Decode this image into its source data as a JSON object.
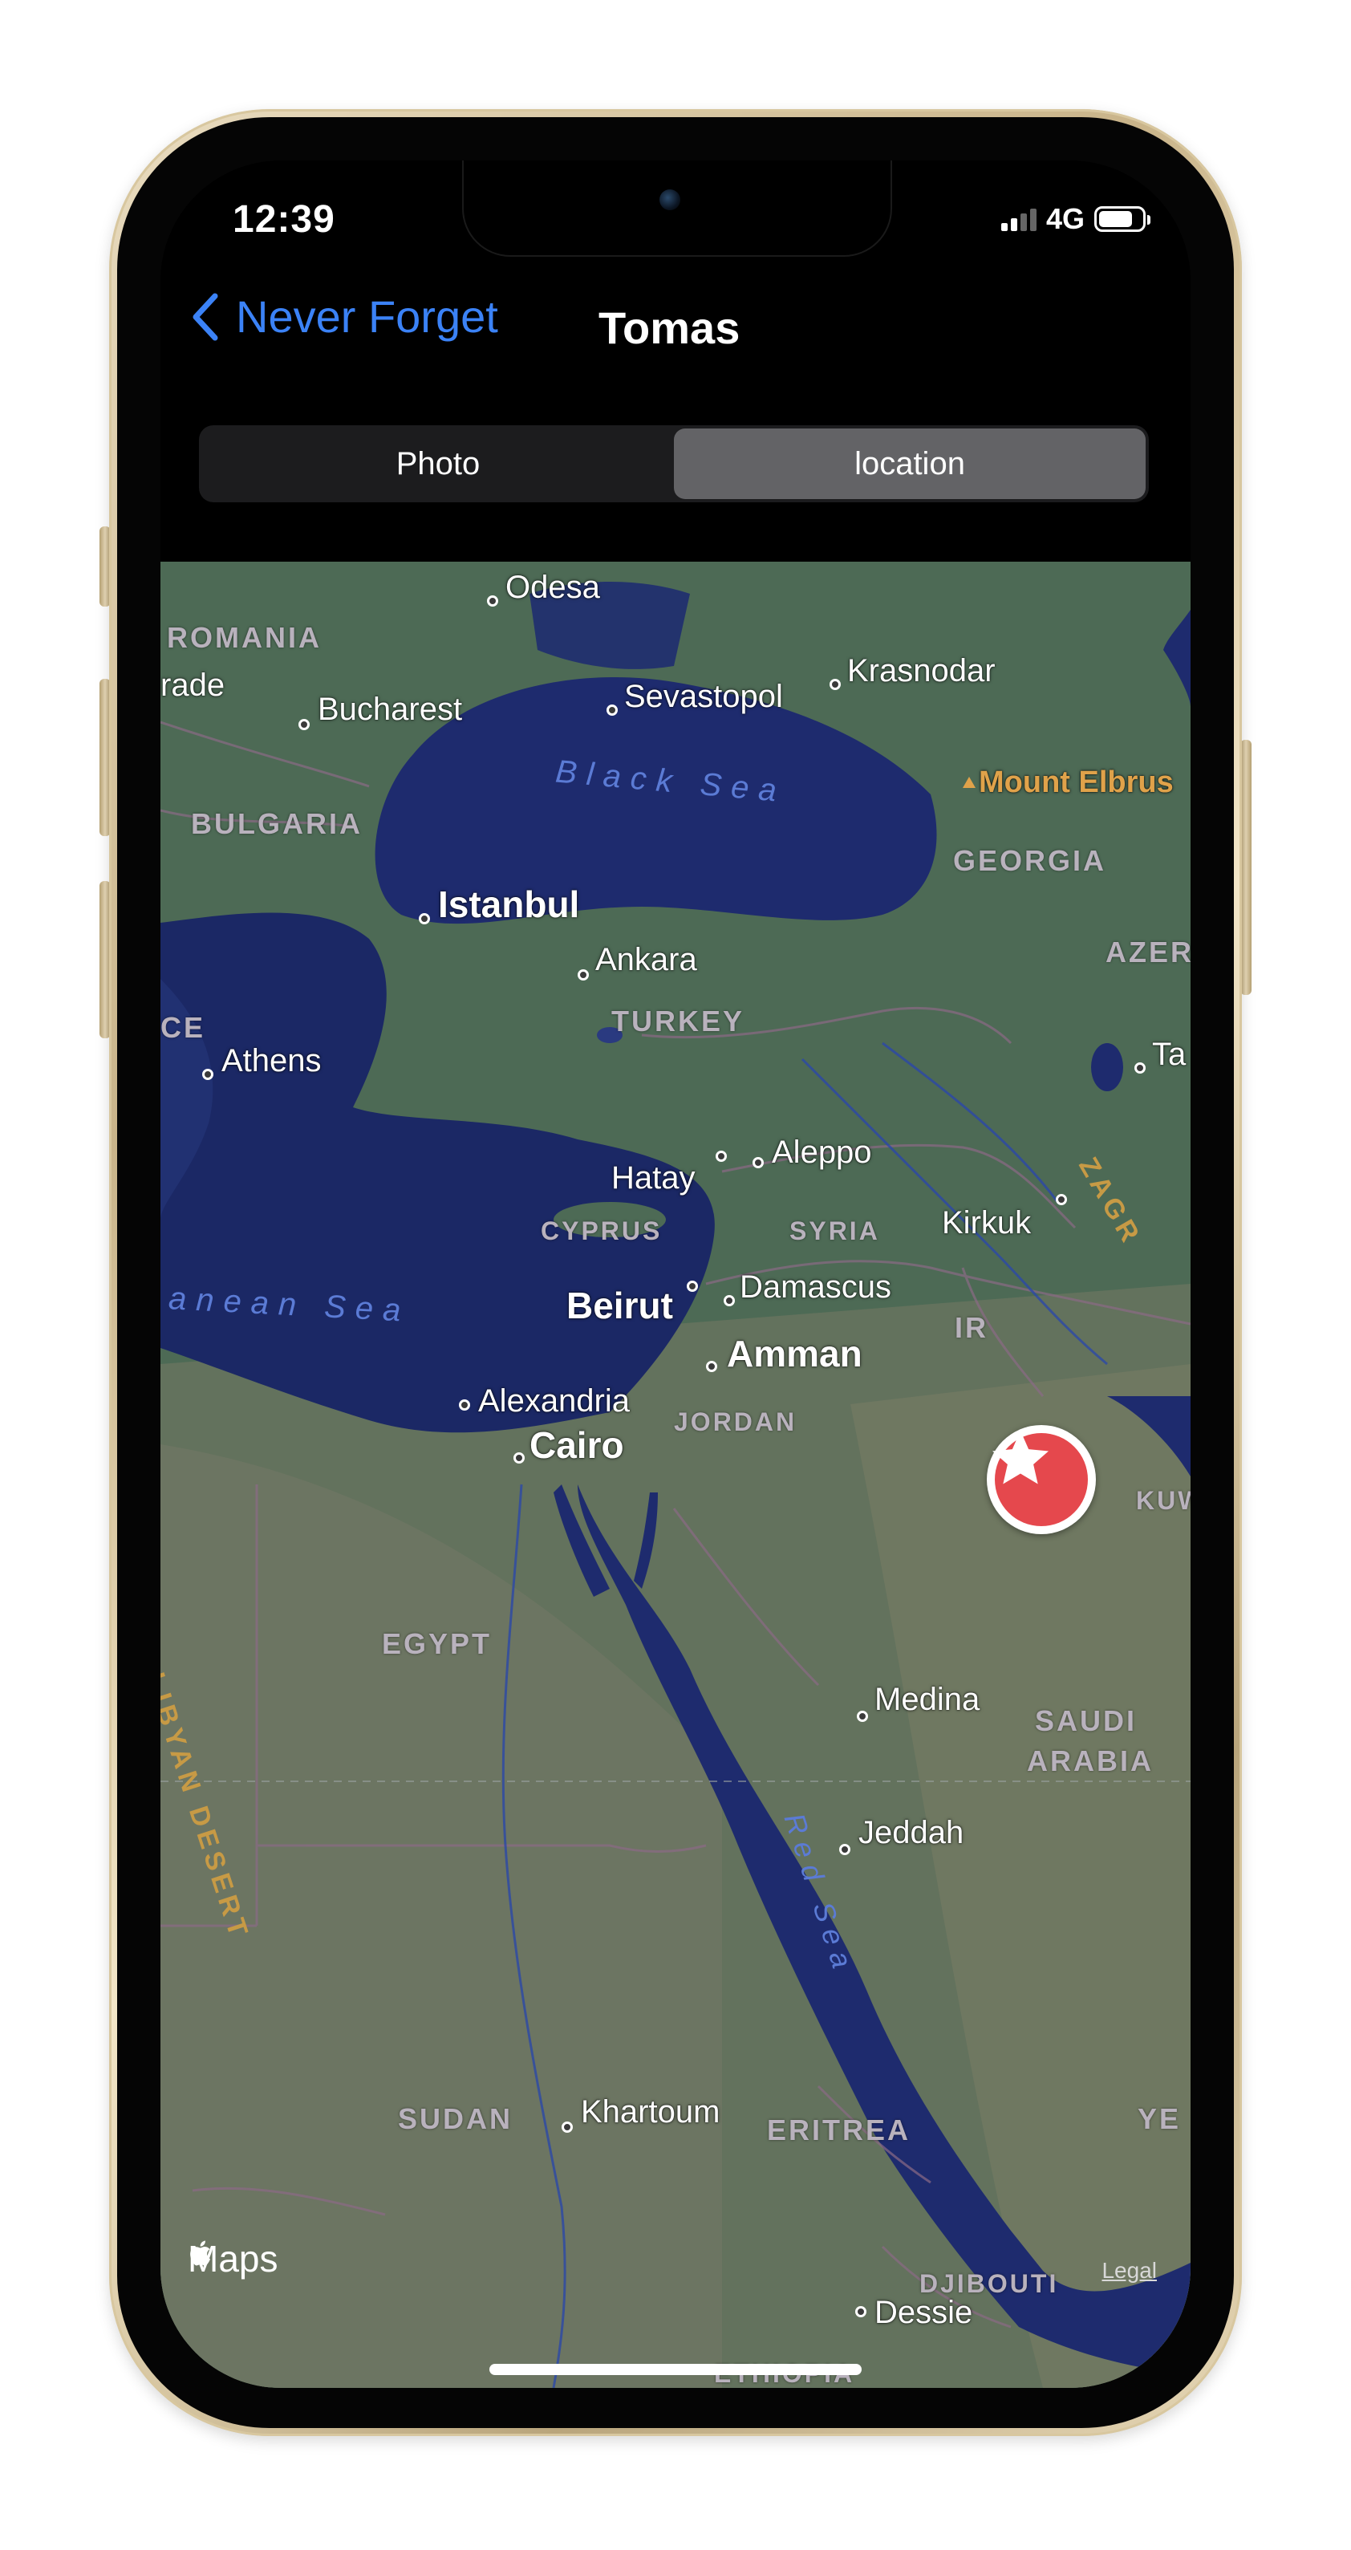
{
  "status_bar": {
    "time": "12:39",
    "network": "4G"
  },
  "nav": {
    "back_label": "Never Forget",
    "title": "Tomas"
  },
  "segments": [
    {
      "label": "Photo",
      "selected": false
    },
    {
      "label": "location",
      "selected": true
    }
  ],
  "map": {
    "cities": {
      "odesa": "Odesa",
      "bucharest": "Bucharest",
      "sevastopol": "Sevastopol",
      "krasnodar": "Krasnodar",
      "istanbul": "Istanbul",
      "ankara": "Ankara",
      "athens": "Athens",
      "hatay": "Hatay",
      "aleppo": "Aleppo",
      "kirkuk": "Kirkuk",
      "beirut": "Beirut",
      "damascus": "Damascus",
      "amman": "Amman",
      "alexandria": "Alexandria",
      "cairo": "Cairo",
      "medina": "Medina",
      "jeddah": "Jeddah",
      "khartoum": "Khartoum",
      "dessie": "Dessie",
      "ta": "Ta",
      "rade": "rade"
    },
    "countries": {
      "romania": "ROMANIA",
      "bulgaria": "BULGARIA",
      "georgia": "GEORGIA",
      "azer": "AZER",
      "turkey": "TURKEY",
      "ce": "CE",
      "cyprus": "CYPRUS",
      "syria": "SYRIA",
      "ir": "IR",
      "jordan": "JORDAN",
      "kuw": "KUW",
      "egypt": "EGYPT",
      "saudi": "SAUDI",
      "arabia": "ARABIA",
      "sudan": "SUDAN",
      "eritrea": "ERITREA",
      "djibouti": "DJIBOUTI",
      "ethiopia": "ETHIOPIA",
      "ye": "YE"
    },
    "water": {
      "black_sea": "Black Sea",
      "med_sea": "anean Sea",
      "red_sea": "Red Sea"
    },
    "features": {
      "mount_elbrus": "Mount Elbrus",
      "libyan_desert": "LIBYAN DESERT",
      "zagr": "ZAGR"
    },
    "attribution": "Maps",
    "legal": "Legal",
    "pin_icon": "star-icon"
  },
  "colors": {
    "accent": "#3b82f6",
    "pin": "#e5484d",
    "land": "#4f6b55",
    "water": "#1d2a6b"
  }
}
